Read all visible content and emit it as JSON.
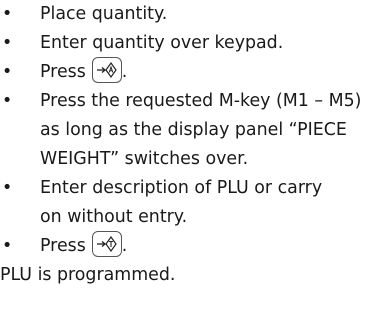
{
  "instructions": {
    "steps": [
      {
        "lines": [
          "Place quantity."
        ]
      },
      {
        "lines": [
          "Enter quantity over keypad."
        ]
      },
      {
        "lines": [
          "Press"
        ],
        "key_icon": "sum-arrow-key-icon",
        "after_key": "."
      },
      {
        "lines": [
          "Press the requested M-key (M1 – M5)",
          "as long as the display panel “PIECE",
          "WEIGHT” switches over."
        ]
      },
      {
        "lines": [
          "Enter description of PLU or carry",
          "on without entry."
        ]
      },
      {
        "lines": [
          "Press"
        ],
        "key_icon": "tare-arrow-key-icon",
        "after_key": "."
      }
    ],
    "bullet_glyph": "•",
    "conclusion": "PLU is programmed."
  }
}
